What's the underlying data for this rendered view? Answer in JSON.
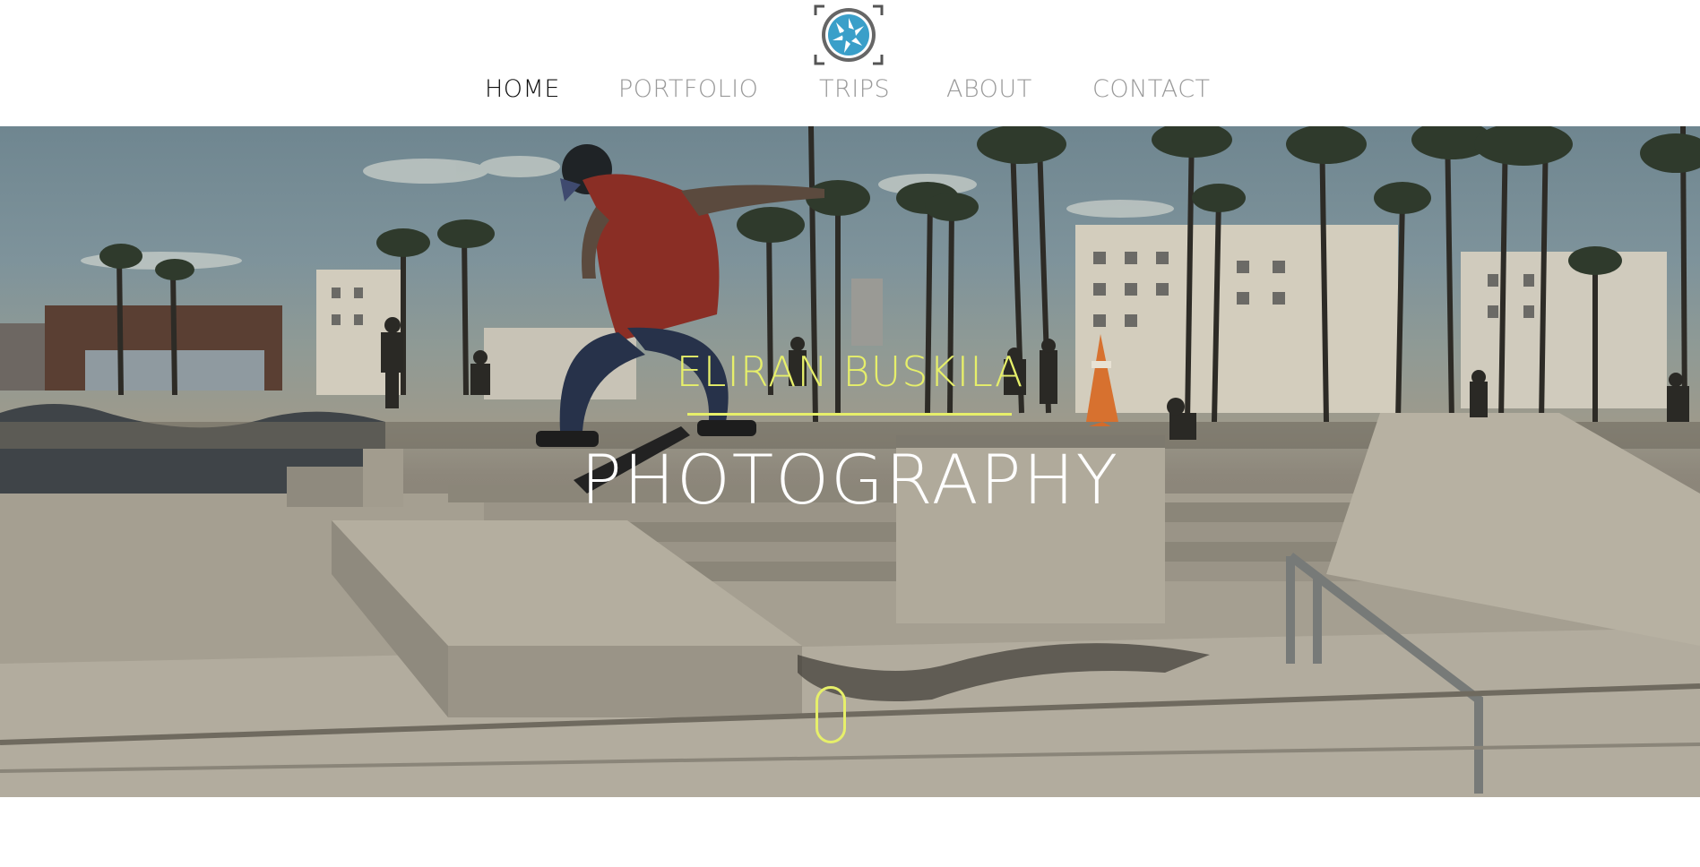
{
  "nav": {
    "items": [
      {
        "label": "HOME",
        "active": true
      },
      {
        "label": "PORTFOLIO",
        "active": false
      },
      {
        "label": "TRIPS",
        "active": false
      },
      {
        "label": "ABOUT",
        "active": false
      },
      {
        "label": "CONTACT",
        "active": false
      }
    ]
  },
  "logo": {
    "icon": "camera-aperture-icon",
    "color": "#3a9fc9"
  },
  "hero": {
    "title_top": "ELIRAN BUSKILA",
    "title_bottom": "PHOTOGRAPHY",
    "accent_color": "#e6ef6a",
    "image": "skatepark-skater-photo"
  },
  "scroll_indicator": {
    "icon": "mouse-scroll-icon"
  }
}
